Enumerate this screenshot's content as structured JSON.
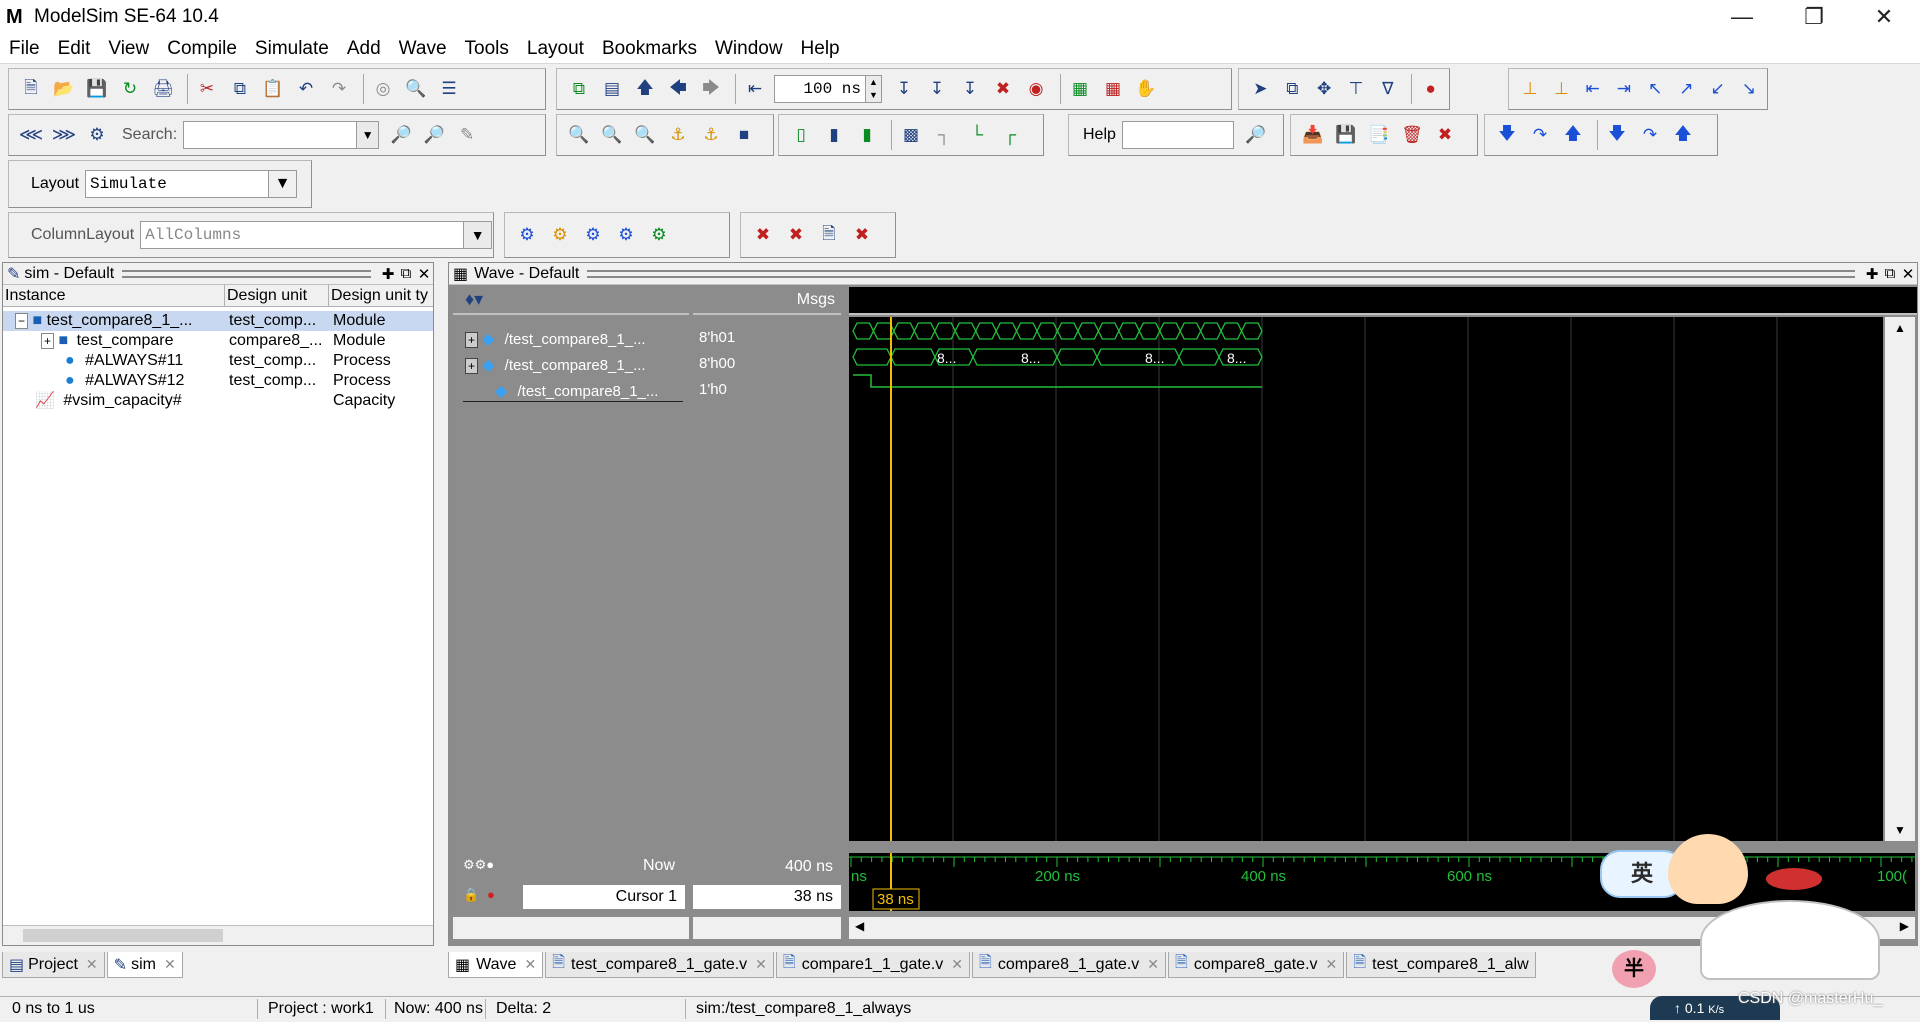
{
  "window": {
    "title": "ModelSim SE-64 10.4"
  },
  "menu": [
    "File",
    "Edit",
    "View",
    "Compile",
    "Simulate",
    "Add",
    "Wave",
    "Tools",
    "Layout",
    "Bookmarks",
    "Window",
    "Help"
  ],
  "toolbar": {
    "time_step_value": "100 ns",
    "search_label": "Search:",
    "search_value": "",
    "help_label": "Help",
    "help_value": "",
    "layout_label": "Layout",
    "layout_value": "Simulate",
    "column_layout_label": "ColumnLayout",
    "column_layout_value": "AllColumns"
  },
  "sim_panel": {
    "title": "sim - Default",
    "columns": [
      "Instance",
      "Design unit",
      "Design unit ty"
    ],
    "rows": [
      {
        "instance": "test_compare8_1_...",
        "unit": "test_comp...",
        "type": "Module"
      },
      {
        "instance": "test_compare",
        "unit": "compare8_...",
        "type": "Module"
      },
      {
        "instance": "#ALWAYS#11",
        "unit": "test_comp...",
        "type": "Process"
      },
      {
        "instance": "#ALWAYS#12",
        "unit": "test_comp...",
        "type": "Process"
      },
      {
        "instance": "#vsim_capacity#",
        "unit": "",
        "type": "Capacity"
      }
    ]
  },
  "wave_panel": {
    "title": "Wave - Default",
    "msgs_label": "Msgs",
    "signals": [
      {
        "name": "/test_compare8_1_...",
        "value": "8'h01"
      },
      {
        "name": "/test_compare8_1_...",
        "value": "8'h00"
      },
      {
        "name": "/test_compare8_1_...",
        "value": "1'h0"
      }
    ],
    "bus_labels": [
      "8...",
      "8...",
      "8...",
      "8..."
    ],
    "now_label": "Now",
    "now_value": "400 ns",
    "cursor_label": "Cursor 1",
    "cursor_value": "38 ns",
    "cursor_tag": "38 ns",
    "time_ticks": [
      "ns",
      "200 ns",
      "400 ns",
      "600 ns",
      "100("
    ]
  },
  "left_tabs": [
    {
      "label": "Project"
    },
    {
      "label": "sim"
    }
  ],
  "editor_tabs": [
    {
      "label": "Wave"
    },
    {
      "label": "test_compare8_1_gate.v"
    },
    {
      "label": "compare1_1_gate.v"
    },
    {
      "label": "compare8_1_gate.v"
    },
    {
      "label": "compare8_gate.v"
    },
    {
      "label": "test_compare8_1_alw"
    }
  ],
  "status": {
    "range": "0 ns to 1 us",
    "project": "Project : work1",
    "now": "Now: 400 ns",
    "delta": "Delta: 2",
    "context": "sim:/test_compare8_1_always"
  },
  "overlay": {
    "ime_char": "英",
    "watermark": "CSDN @masterHu_",
    "net_speed": "0.1",
    "net_unit": "K/s",
    "badge_char": "半"
  },
  "colors": {
    "wave_green": "#22c03a",
    "cursor_yellow": "#f0c000",
    "canvas_bg": "#000000"
  }
}
